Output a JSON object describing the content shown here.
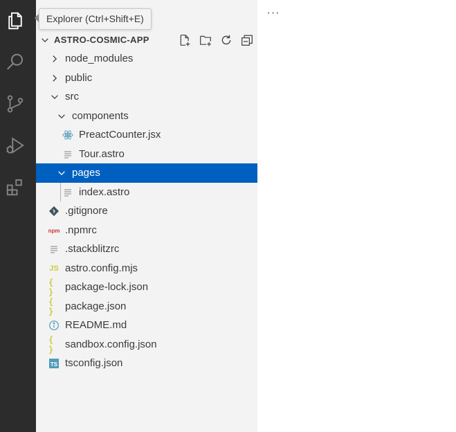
{
  "tooltip": {
    "text": "Explorer (Ctrl+Shift+E)"
  },
  "explorer": {
    "more_actions": "···",
    "section_title": "ASTRO-COSMIC-APP",
    "header_actions": [
      "new-file-icon",
      "new-folder-icon",
      "refresh-icon",
      "collapse-all-icon"
    ],
    "items": [
      {
        "label": "node_modules",
        "type": "folder",
        "expanded": false,
        "depth": 0
      },
      {
        "label": "public",
        "type": "folder",
        "expanded": false,
        "depth": 0
      },
      {
        "label": "src",
        "type": "folder",
        "expanded": true,
        "depth": 0
      },
      {
        "label": "components",
        "type": "folder",
        "expanded": true,
        "depth": 1
      },
      {
        "label": "PreactCounter.jsx",
        "type": "file",
        "icon": "react-icon",
        "depth": 2
      },
      {
        "label": "Tour.astro",
        "type": "file",
        "icon": "lines-icon",
        "depth": 2
      },
      {
        "label": "pages",
        "type": "folder",
        "expanded": true,
        "depth": 1,
        "selected": true
      },
      {
        "label": "index.astro",
        "type": "file",
        "icon": "lines-icon",
        "depth": 2
      },
      {
        "label": ".gitignore",
        "type": "file",
        "icon": "git-icon",
        "depth": 0
      },
      {
        "label": ".npmrc",
        "type": "file",
        "icon": "npm-icon",
        "depth": 0
      },
      {
        "label": ".stackblitzrc",
        "type": "file",
        "icon": "lines-icon",
        "depth": 0
      },
      {
        "label": "astro.config.mjs",
        "type": "file",
        "icon": "js-icon",
        "depth": 0
      },
      {
        "label": "package-lock.json",
        "type": "file",
        "icon": "json-icon",
        "depth": 0
      },
      {
        "label": "package.json",
        "type": "file",
        "icon": "json-icon",
        "depth": 0
      },
      {
        "label": "README.md",
        "type": "file",
        "icon": "info-icon",
        "depth": 0
      },
      {
        "label": "sandbox.config.json",
        "type": "file",
        "icon": "json-icon",
        "depth": 0
      },
      {
        "label": "tsconfig.json",
        "type": "file",
        "icon": "ts-icon",
        "depth": 0
      }
    ]
  },
  "activity_bar": {
    "items": [
      "explorer-icon",
      "search-icon",
      "source-control-icon",
      "run-debug-icon",
      "extensions-icon"
    ]
  },
  "colors": {
    "activity_bar": "#2c2c2c",
    "sidebar": "#f3f3f3",
    "selection": "#0060c0",
    "icon_gray": "#858585"
  },
  "icon_glyphs": {
    "js": "JS",
    "ts": "TS",
    "npm": "npm",
    "json": "{ }"
  }
}
